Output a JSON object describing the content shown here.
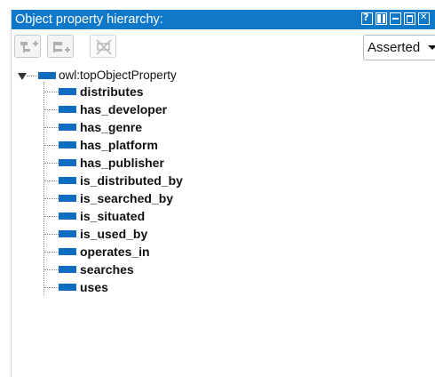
{
  "panel": {
    "title": "Object property hierarchy:"
  },
  "window_buttons": [
    "help-icon",
    "split-icon",
    "minimize-icon",
    "maximize-icon",
    "close-icon"
  ],
  "toolbar": {
    "buttons": [
      "add-subproperty-icon",
      "add-sibling-property-icon",
      "delete-property-icon"
    ],
    "view_mode": "Asserted"
  },
  "tree": {
    "root": "owl:topObjectProperty",
    "children": [
      "distributes",
      "has_developer",
      "has_genre",
      "has_platform",
      "has_publisher",
      "is_distributed_by",
      "is_searched_by",
      "is_situated",
      "is_used_by",
      "operates_in",
      "searches",
      "uses"
    ]
  },
  "colors": {
    "titlebar": "#0f78c8",
    "property_icon": "#0f6cbf"
  }
}
